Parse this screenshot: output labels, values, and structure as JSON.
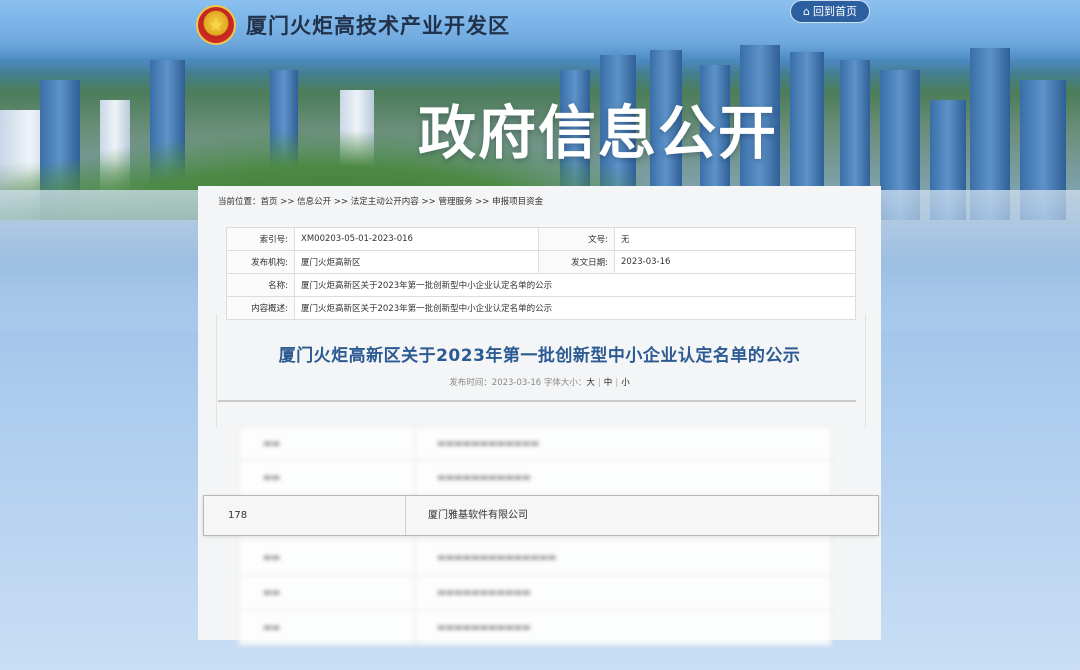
{
  "header": {
    "emblem": "national-emblem",
    "site_name": "厦门火炬高技术产业开发区",
    "home_button": "回到首页",
    "home_icon": "home-icon"
  },
  "hero": {
    "title": "政府信息公开"
  },
  "breadcrumb": {
    "text": "当前位置：首页 >> 信息公开 >> 法定主动公开内容 >> 管理服务 >> 申报项目资金"
  },
  "meta": {
    "index_label": "索引号:",
    "index_value": "XM00203-05-01-2023-016",
    "docno_label": "文号:",
    "docno_value": "无",
    "publisher_label": "发布机构:",
    "publisher_value": "厦门火炬高新区",
    "date_label": "发文日期:",
    "date_value": "2023-03-16",
    "name_label": "名称:",
    "name_value": "厦门火炬高新区关于2023年第一批创新型中小企业认定名单的公示",
    "summary_label": "内容概述:",
    "summary_value": "厦门火炬高新区关于2023年第一批创新型中小企业认定名单的公示"
  },
  "article": {
    "title": "厦门火炬高新区关于2023年第一批创新型中小企业认定名单的公示",
    "publish_prefix": "发布时间：2023-03-16 字体大小：",
    "size_large": "大",
    "size_medium": "中",
    "size_small": "小"
  },
  "list": {
    "highlight": {
      "no": "178",
      "name": "厦门雅基软件有限公司"
    }
  },
  "colors": {
    "accent": "#2c5b93",
    "home_button_bg": "#2c5fa0"
  }
}
